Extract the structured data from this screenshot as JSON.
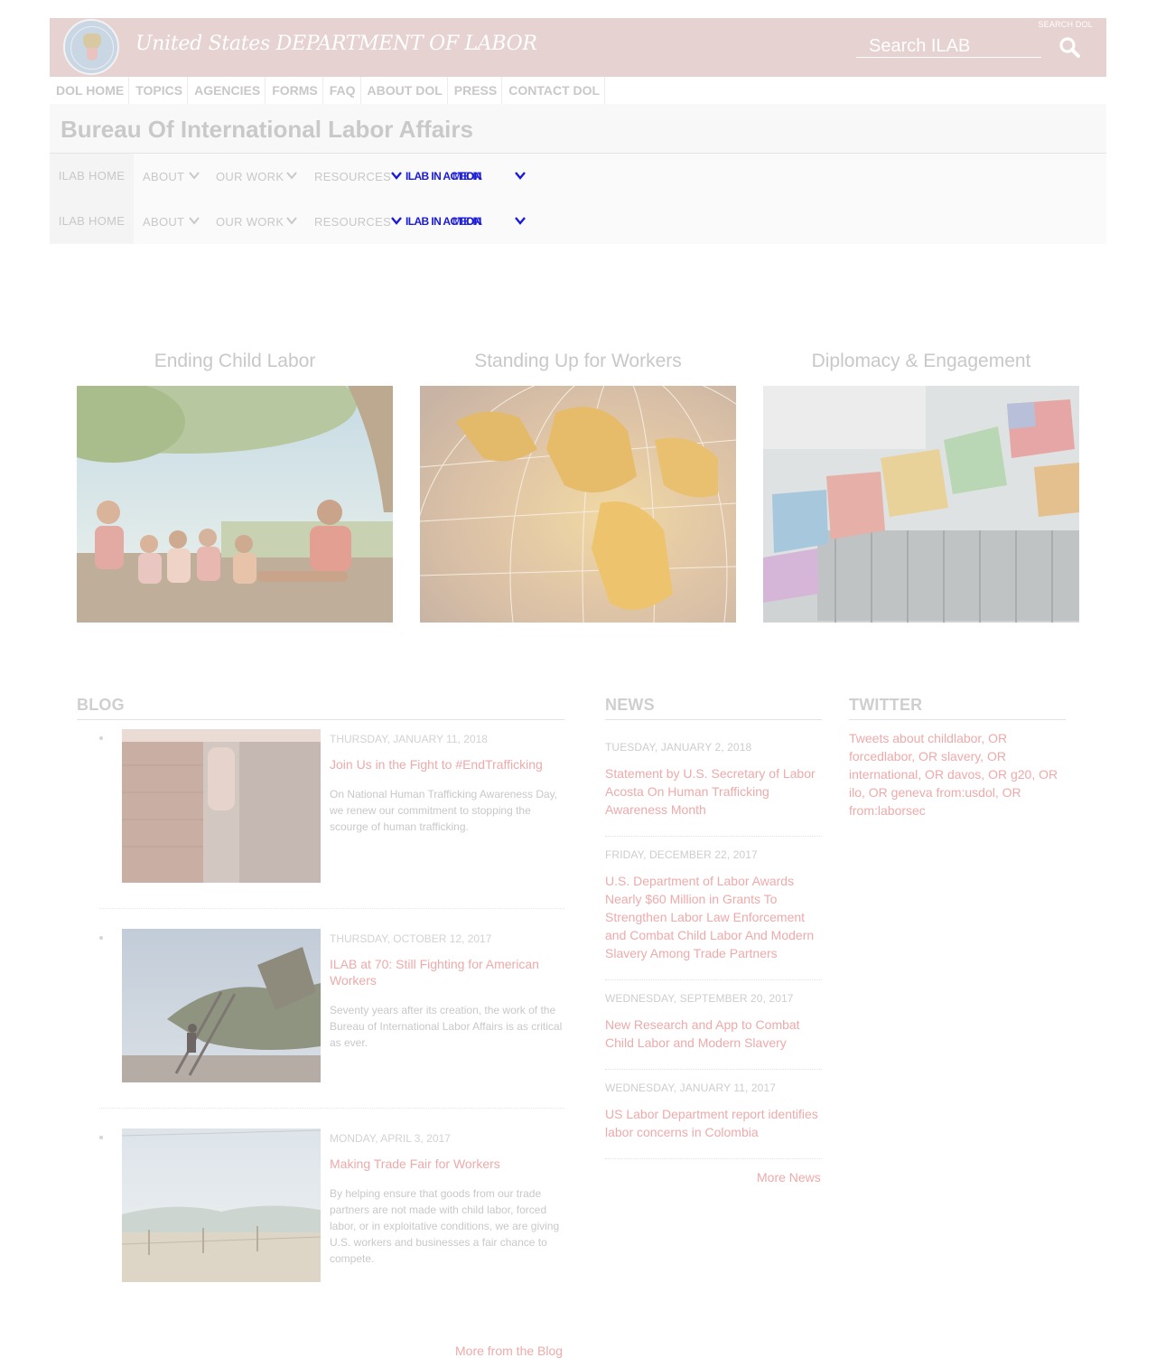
{
  "header": {
    "title": "United States DEPARTMENT OF LABOR",
    "search_label": "SEARCH DOL",
    "search_placeholder": "Search ILAB"
  },
  "dol_nav": [
    "DOL HOME",
    "TOPICS",
    "AGENCIES",
    "FORMS",
    "FAQ",
    "ABOUT DOL",
    "PRESS",
    "CONTACT DOL"
  ],
  "bureau_title": "Bureau Of International Labor Affairs",
  "ilab_nav": {
    "home": "ILAB HOME",
    "about": "ABOUT",
    "our_work": "OUR WORK",
    "resources": "RESOURCES",
    "overlay_text": "ILAB IN ACTION",
    "overlay_text_2": "MEDIA"
  },
  "features": [
    {
      "title": "Ending Child Labor"
    },
    {
      "title": "Standing Up for Workers"
    },
    {
      "title": "Diplomacy & Engagement"
    }
  ],
  "blog": {
    "heading": "BLOG",
    "posts": [
      {
        "date": "THURSDAY, JANUARY 11, 2018",
        "title": "Join Us in the Fight to #EndTrafficking",
        "summary": "On National Human Trafficking Awareness Day, we renew our commitment to stopping the scourge of human trafficking."
      },
      {
        "date": "THURSDAY, OCTOBER 12, 2017",
        "title": "ILAB at 70: Still Fighting for American Workers",
        "summary": "Seventy years after its creation, the work of the Bureau of International Labor Affairs is as critical as ever."
      },
      {
        "date": "MONDAY, APRIL 3, 2017",
        "title": "Making Trade Fair for Workers",
        "summary": "By helping ensure that goods from our trade partners are not made with child labor, forced labor, or in exploitative conditions, we are giving U.S. workers and businesses a fair chance to compete."
      }
    ],
    "more": "More from the Blog"
  },
  "news": {
    "heading": "NEWS",
    "items": [
      {
        "date": "TUESDAY, JANUARY 2, 2018",
        "title": "Statement by U.S. Secretary of Labor Acosta On Human Trafficking Awareness Month"
      },
      {
        "date": "FRIDAY, DECEMBER 22, 2017",
        "title": "U.S. Department of Labor Awards Nearly $60 Million in Grants To Strengthen Labor Law Enforcement and Combat Child Labor And Modern Slavery Among Trade Partners"
      },
      {
        "date": "WEDNESDAY, SEPTEMBER 20, 2017",
        "title": "New Research and App to Combat Child Labor and Modern Slavery"
      },
      {
        "date": "WEDNESDAY, JANUARY 11, 2017",
        "title": "US Labor Department report identifies labor concerns in Colombia"
      }
    ],
    "more": "More News"
  },
  "twitter": {
    "heading": "TWITTER",
    "link": "Tweets about childlabor, OR forcedlabor, OR slavery, OR international, OR davos, OR g20, OR ilo, OR geneva from:usdol, OR from:laborsec"
  },
  "colors": {
    "header_bg": "#e6d2d0",
    "link": "#eeaaaa",
    "overlay_blue": "#1a1ad9"
  },
  "icons": [
    "dol-seal-icon",
    "search-icon",
    "chevron-down-icon"
  ]
}
